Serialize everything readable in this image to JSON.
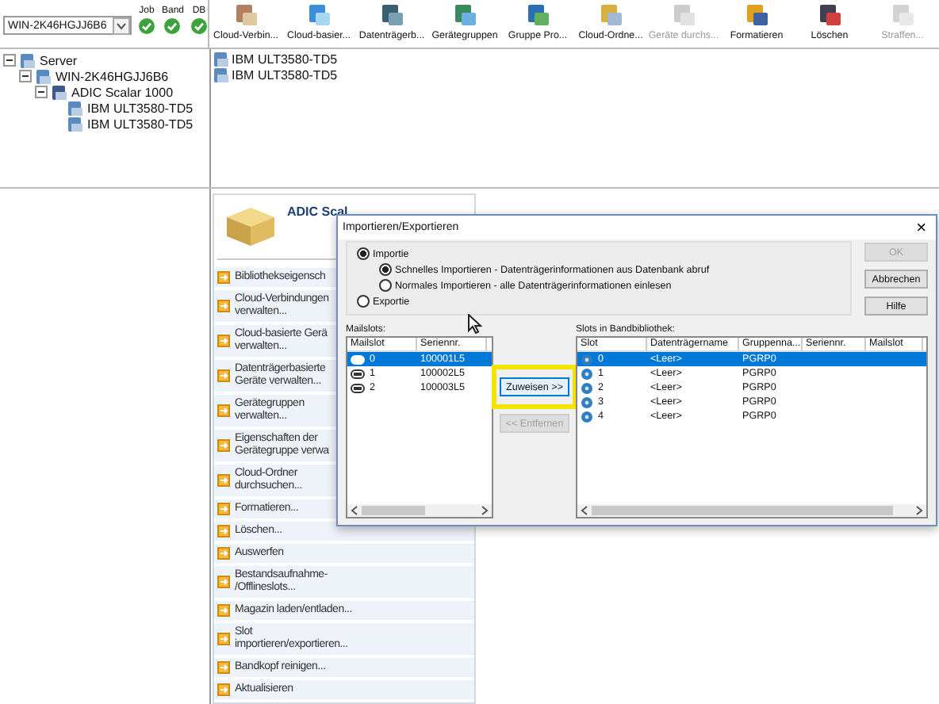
{
  "server_selector": {
    "value": "WIN-2K46HGJJ6B6"
  },
  "status": [
    {
      "label": "Job",
      "ok": true
    },
    {
      "label": "Band",
      "ok": true
    },
    {
      "label": "DB",
      "ok": true
    }
  ],
  "toolbar": [
    {
      "label": "Cloud-Verbin...",
      "disabled": false
    },
    {
      "label": "Cloud-basier...",
      "disabled": false
    },
    {
      "label": "Datenträgerb...",
      "disabled": false
    },
    {
      "label": "Gerätegruppen",
      "disabled": false
    },
    {
      "label": "Gruppe Pro...",
      "disabled": false
    },
    {
      "label": "Cloud-Ordne...",
      "disabled": false
    },
    {
      "label": "Geräte durchs...",
      "disabled": true
    },
    {
      "label": "Formatieren",
      "disabled": false
    },
    {
      "label": "Löschen",
      "disabled": false
    },
    {
      "label": "Straffen...",
      "disabled": true
    }
  ],
  "tree": [
    {
      "label": "Server",
      "expanded": true,
      "children": [
        {
          "label": "WIN-2K46HGJJ6B6",
          "expanded": true,
          "children": [
            {
              "label": "ADIC Scalar 1000",
              "expanded": true,
              "children": [
                {
                  "label": "IBM ULT3580-TD5"
                },
                {
                  "label": "IBM ULT3580-TD5"
                }
              ]
            }
          ]
        }
      ]
    }
  ],
  "device_list": [
    "IBM ULT3580-TD5",
    "IBM ULT3580-TD5"
  ],
  "task_panel": {
    "title": "ADIC Scal",
    "items": [
      "Bibliothekseigensch",
      "Cloud-Verbindungen\nverwalten...",
      "Cloud-basierte Gerä\nverwalten...",
      "Datenträgerbasierte\nGeräte verwalten...",
      "Gerätegruppen\nverwalten...",
      "Eigenschaften der\nGerätegruppe verwa",
      "Cloud-Ordner\ndurchsuchen...",
      "Formatieren...",
      "Löschen...",
      "Auswerfen",
      "Bestandsaufnahme-\n/Offlineslots...",
      "Magazin laden/entladen...",
      "Slot\nimportieren/exportieren...",
      "Bandkopf reinigen...",
      "Aktualisieren"
    ]
  },
  "dialog": {
    "title": "Importieren/Exportieren",
    "close": "×",
    "modes": [
      {
        "label": "Importie",
        "selected": true,
        "options": [
          {
            "label": "Schnelles Importieren - Datenträgerinformationen aus Datenbank abruf",
            "selected": true
          },
          {
            "label": "Normales Importieren - alle Datenträgerinformationen einlesen",
            "selected": false
          }
        ]
      },
      {
        "label": "Exportie",
        "selected": false
      }
    ],
    "buttons": [
      {
        "label": "OK",
        "disabled": true
      },
      {
        "label": "Abbrechen",
        "disabled": false
      },
      {
        "label": "Hilfe",
        "disabled": false
      }
    ],
    "mailslots": {
      "label": "Mailslots:",
      "columns": [
        "Mailslot",
        "Seriennr."
      ],
      "rows": [
        {
          "cells": [
            "0",
            "100001L5"
          ],
          "selected": true
        },
        {
          "cells": [
            "1",
            "100002L5"
          ],
          "selected": false
        },
        {
          "cells": [
            "2",
            "100003L5"
          ],
          "selected": false
        }
      ]
    },
    "assign": {
      "label": "Zuweisen >>",
      "highlighted": true
    },
    "remove": {
      "label": "<< Entfernen",
      "disabled": true
    },
    "slots": {
      "label": "Slots in Bandbibliothek:",
      "columns": [
        "Slot",
        "Datenträgername",
        "Gruppenna...",
        "Seriennr.",
        "Mailslot"
      ],
      "rows": [
        {
          "cells": [
            "0",
            "<Leer>",
            "PGRP0",
            "",
            ""
          ],
          "selected": true
        },
        {
          "cells": [
            "1",
            "<Leer>",
            "PGRP0",
            "",
            ""
          ],
          "selected": false
        },
        {
          "cells": [
            "2",
            "<Leer>",
            "PGRP0",
            "",
            ""
          ],
          "selected": false
        },
        {
          "cells": [
            "3",
            "<Leer>",
            "PGRP0",
            "",
            ""
          ],
          "selected": false
        },
        {
          "cells": [
            "4",
            "<Leer>",
            "PGRP0",
            "",
            ""
          ],
          "selected": false
        }
      ]
    }
  }
}
